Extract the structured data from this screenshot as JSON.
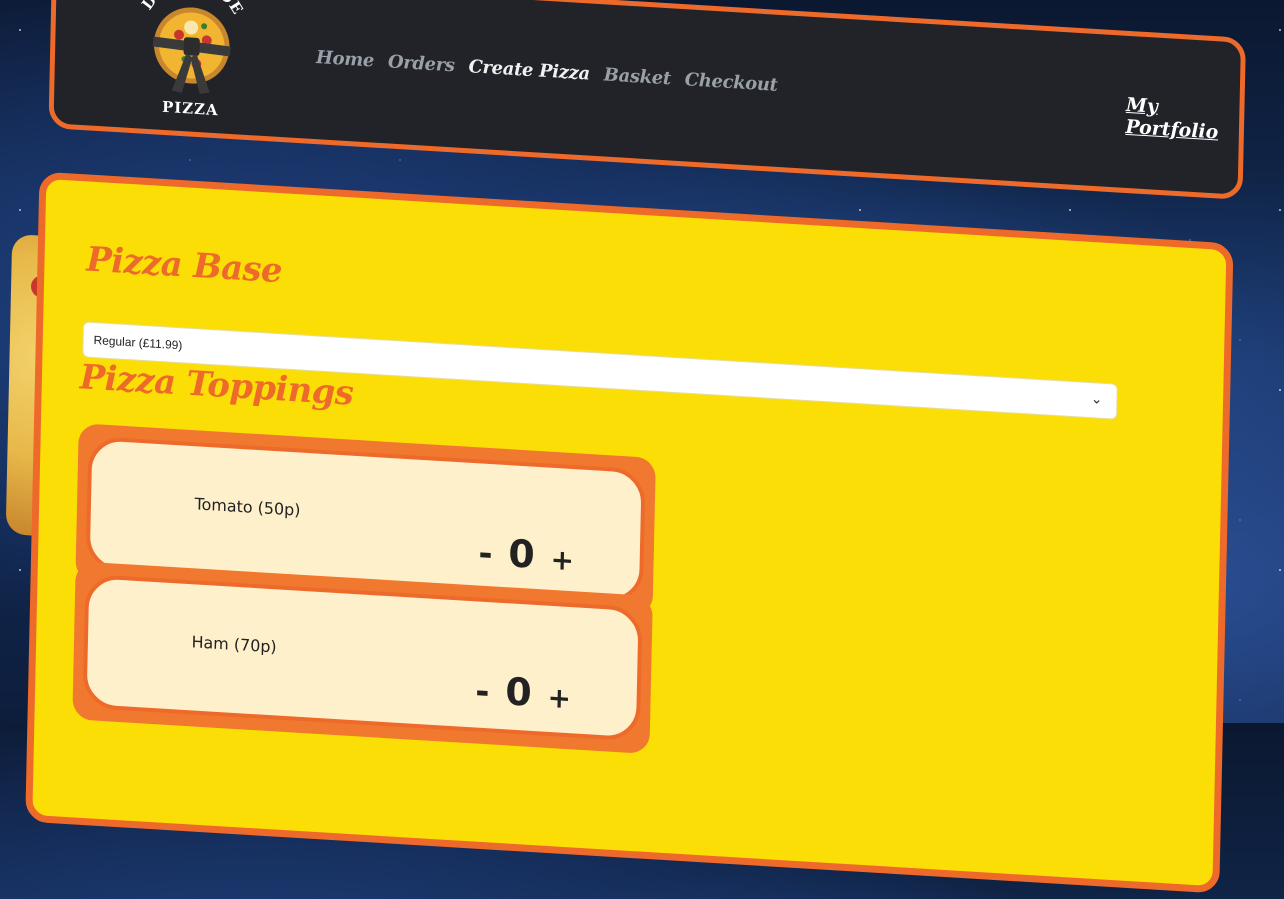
{
  "brand": {
    "logo_top": "DOUGHJOE",
    "logo_bottom": "PIZZA"
  },
  "nav": {
    "items": [
      {
        "label": "Home",
        "active": false
      },
      {
        "label": "Orders",
        "active": false
      },
      {
        "label": "Create Pizza",
        "active": true
      },
      {
        "label": "Basket",
        "active": false
      },
      {
        "label": "Checkout",
        "active": false
      }
    ],
    "portfolio": "My Portfolio"
  },
  "base": {
    "heading": "Pizza Base",
    "selected": "Regular (£11.99)"
  },
  "toppings": {
    "heading": "Pizza Toppings",
    "items": [
      {
        "name": "Tomato (50p)",
        "count": "0",
        "minus": "-",
        "plus": "+"
      },
      {
        "name": "Ham (70p)",
        "count": "0",
        "minus": "-",
        "plus": "+"
      }
    ]
  },
  "colors": {
    "accent": "#ee6a2b",
    "card": "#fbde06",
    "nav_bg": "#212329",
    "topping_bg": "#fff0cc"
  }
}
